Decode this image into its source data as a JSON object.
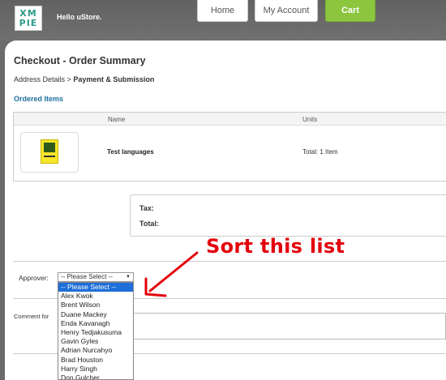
{
  "header": {
    "logo_line1": "XM",
    "logo_line2": "PIE",
    "greeting": "Hello uStore.",
    "nav": {
      "home": "Home",
      "account": "My Account",
      "cart": "Cart"
    }
  },
  "page": {
    "title": "Checkout - Order Summary",
    "breadcrumb": {
      "step1": "Address Details",
      "separator": ">",
      "current": "Payment & Submission"
    },
    "ordered_items_title": "Ordered Items"
  },
  "items_table": {
    "columns": {
      "name": "Name",
      "units": "Units"
    },
    "rows": [
      {
        "name": "Test languages",
        "units": "Total: 1 Item"
      }
    ]
  },
  "totals": {
    "tax_label": "Tax:",
    "total_label": "Total:"
  },
  "approver": {
    "label": "Approver:",
    "selected": "-- Please Select --",
    "options": [
      "-- Please Select --",
      "Alex Kwok",
      "Brent Wilson",
      "Duane Mackey",
      "Enda Kavanagh",
      "Henry Tedjakusuma",
      "Gavin Gyles",
      "Adrian Nurcahyo",
      "Brad Houston",
      "Harry Singh",
      "Don Gulcher"
    ]
  },
  "comment": {
    "label": "Comment for"
  },
  "annotation": {
    "text": "Sort this list",
    "color": "#e3000b"
  },
  "colors": {
    "cart_green": "#8cc63f",
    "section_blue": "#1f6f9f",
    "selected_option": "#1e6fd9"
  }
}
